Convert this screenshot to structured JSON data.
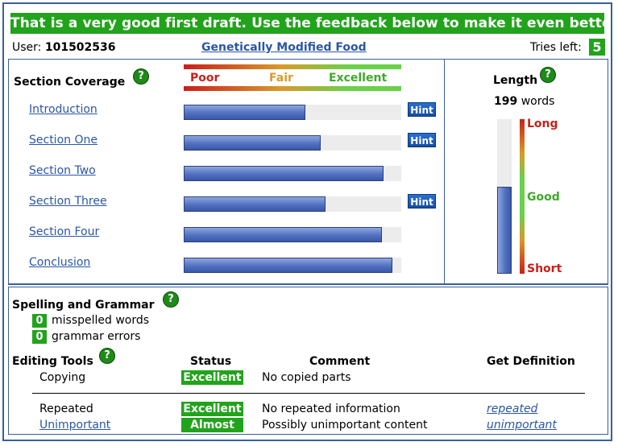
{
  "banner": "That is a very good first draft. Use the feedback below to make it even better.",
  "user": {
    "label": "User:",
    "id": "101502536"
  },
  "document_title": "Genetically Modified Food",
  "tries": {
    "label": "Tries left:",
    "count": "5"
  },
  "help_glyph": "?",
  "coverage": {
    "title": "Section Coverage",
    "scale": {
      "poor": "Poor",
      "fair": "Fair",
      "excellent": "Excellent"
    },
    "sections": [
      {
        "label": "Introduction",
        "coverage": 0.56,
        "hint": "Hint"
      },
      {
        "label": "Section One",
        "coverage": 0.63,
        "hint": "Hint"
      },
      {
        "label": "Section Two",
        "coverage": 0.92,
        "hint": ""
      },
      {
        "label": "Section Three",
        "coverage": 0.65,
        "hint": "Hint"
      },
      {
        "label": "Section Four",
        "coverage": 0.91,
        "hint": ""
      },
      {
        "label": "Conclusion",
        "coverage": 0.96,
        "hint": ""
      }
    ]
  },
  "length": {
    "title": "Length",
    "count": "199",
    "unit": "words",
    "level": 0.56,
    "scale": {
      "long": "Long",
      "good": "Good",
      "short": "Short"
    }
  },
  "spelling": {
    "title": "Spelling and Grammar",
    "misspelled_count": "0",
    "misspelled_label": "misspelled words",
    "grammar_count": "0",
    "grammar_label": "grammar errors"
  },
  "editing": {
    "title": "Editing Tools",
    "columns": {
      "status": "Status",
      "comment": "Comment",
      "definition": "Get Definition"
    },
    "rows": [
      {
        "tool": "Copying",
        "status": "Excellent",
        "comment": "No copied parts",
        "definition": ""
      },
      {
        "tool": "Repeated",
        "status": "Excellent",
        "comment": "No repeated information",
        "definition": "repeated"
      },
      {
        "tool": "Unimportant",
        "status": "Almost",
        "comment": "Possibly unimportant content",
        "definition": "unimportant"
      }
    ]
  },
  "colors": {
    "accent_green": "#22a31c",
    "link_blue": "#2a56a6",
    "border_blue": "#3a5f96",
    "poor_red": "#c8201a",
    "fair_orange": "#d99a2a",
    "excellent_green": "#6bd04a"
  }
}
